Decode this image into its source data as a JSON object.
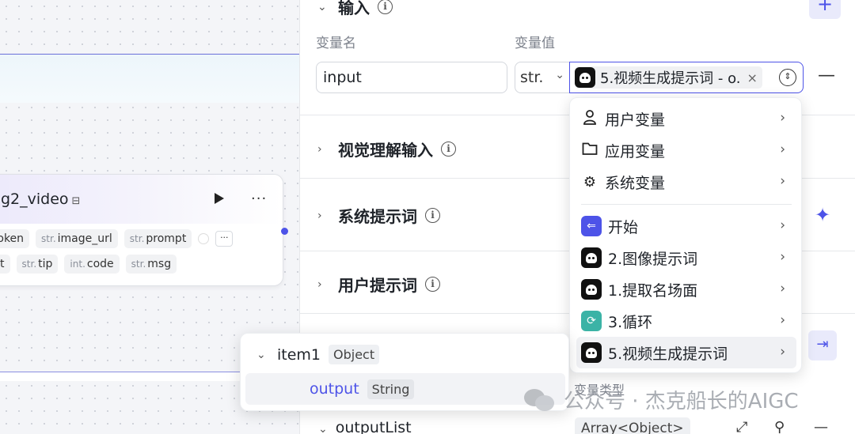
{
  "canvas": {
    "node": {
      "title": "g2_video",
      "title_icon": "robot-icon",
      "inputs": [
        {
          "type": "",
          "name": "i_token"
        },
        {
          "type": "str.",
          "name": "image_url"
        },
        {
          "type": "str.",
          "name": "prompt"
        }
      ],
      "more_label": "···",
      "outputs": [
        {
          "type": "",
          "name": "sult"
        },
        {
          "type": "str.",
          "name": "tip"
        },
        {
          "type": "int.",
          "name": "code"
        },
        {
          "type": "str.",
          "name": "msg"
        }
      ]
    }
  },
  "panel": {
    "input_section": {
      "title": "输入",
      "col_name": "变量名",
      "col_value": "变量值"
    },
    "var_row": {
      "name_value": "input",
      "type_value": "str.",
      "ref_value": "5.视频生成提示词 - o."
    },
    "sections": [
      {
        "title": "视觉理解输入"
      },
      {
        "title": "系统提示词"
      },
      {
        "title": "用户提示词"
      }
    ],
    "output": {
      "label": "变量类型",
      "row_name": "outputList",
      "row_type": "Array<Object>"
    }
  },
  "menu": {
    "groups": [
      {
        "label": "用户变量",
        "icon": "user-icon"
      },
      {
        "label": "应用变量",
        "icon": "folder-icon"
      },
      {
        "label": "系统变量",
        "icon": "gear-icon"
      }
    ],
    "nodes": [
      {
        "label": "开始",
        "icon": "start-icon",
        "color": "#4d53e8"
      },
      {
        "label": "2.图像提示词",
        "icon": "bot-icon",
        "color": "#111111"
      },
      {
        "label": "1.提取名场面",
        "icon": "bot-icon",
        "color": "#111111"
      },
      {
        "label": "3.循环",
        "icon": "loop-icon",
        "color": "#3bb3a6"
      },
      {
        "label": "5.视频生成提示词",
        "icon": "bot-icon",
        "color": "#111111"
      }
    ]
  },
  "tooltip": {
    "item_name": "item1",
    "item_type": "Object",
    "field_name": "output",
    "field_type": "String"
  },
  "watermark": {
    "text": "公众号 · 杰克船长的AIGC"
  },
  "colors": {
    "accent": "#4d53e8",
    "loop": "#3bb3a6"
  }
}
